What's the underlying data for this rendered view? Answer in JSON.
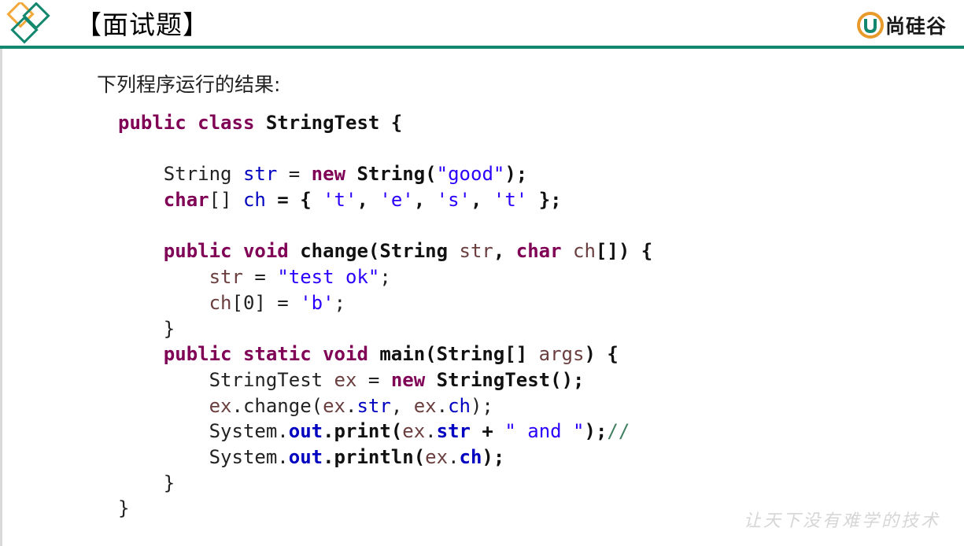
{
  "header": {
    "title": "【面试题】",
    "brand_name": "尚硅谷",
    "accent_color": "#14886f",
    "logo_colors": [
      "#f2a93b",
      "#14886f"
    ]
  },
  "question": "下列程序运行的结果:",
  "code_lines": [
    [
      {
        "t": "public",
        "c": "kw"
      },
      {
        "t": " "
      },
      {
        "t": "class",
        "c": "kw"
      },
      {
        "t": " "
      },
      {
        "t": "StringTest",
        "c": "cls"
      },
      {
        "t": " {",
        "c": "cls"
      }
    ],
    [],
    [
      {
        "t": "    String ",
        "c": "typ"
      },
      {
        "t": "str",
        "c": "fld"
      },
      {
        "t": " = "
      },
      {
        "t": "new",
        "c": "kw"
      },
      {
        "t": " "
      },
      {
        "t": "String(",
        "c": "cls"
      },
      {
        "t": "\"good\"",
        "c": "str"
      },
      {
        "t": ");",
        "c": "cls"
      }
    ],
    [
      {
        "t": "    "
      },
      {
        "t": "char",
        "c": "kw"
      },
      {
        "t": "[] "
      },
      {
        "t": "ch",
        "c": "fld"
      },
      {
        "t": " = { ",
        "c": "cls"
      },
      {
        "t": "'t'",
        "c": "str"
      },
      {
        "t": ", ",
        "c": "cls"
      },
      {
        "t": "'e'",
        "c": "str"
      },
      {
        "t": ", ",
        "c": "cls"
      },
      {
        "t": "'s'",
        "c": "str"
      },
      {
        "t": ", ",
        "c": "cls"
      },
      {
        "t": "'t'",
        "c": "str"
      },
      {
        "t": " };",
        "c": "cls"
      }
    ],
    [],
    [
      {
        "t": "    "
      },
      {
        "t": "public",
        "c": "kw"
      },
      {
        "t": " "
      },
      {
        "t": "void",
        "c": "kw"
      },
      {
        "t": " "
      },
      {
        "t": "change(String ",
        "c": "cls"
      },
      {
        "t": "str",
        "c": "var"
      },
      {
        "t": ", ",
        "c": "cls"
      },
      {
        "t": "char",
        "c": "kw"
      },
      {
        "t": " "
      },
      {
        "t": "ch",
        "c": "var"
      },
      {
        "t": "[]) {",
        "c": "cls"
      }
    ],
    [
      {
        "t": "        "
      },
      {
        "t": "str",
        "c": "var"
      },
      {
        "t": " = "
      },
      {
        "t": "\"test ok\"",
        "c": "str"
      },
      {
        "t": ";"
      }
    ],
    [
      {
        "t": "        "
      },
      {
        "t": "ch",
        "c": "var"
      },
      {
        "t": "[0] = "
      },
      {
        "t": "'b'",
        "c": "str"
      },
      {
        "t": ";"
      }
    ],
    [
      {
        "t": "    }"
      }
    ],
    [
      {
        "t": "    "
      },
      {
        "t": "public",
        "c": "kw"
      },
      {
        "t": " "
      },
      {
        "t": "static",
        "c": "kw"
      },
      {
        "t": " "
      },
      {
        "t": "void",
        "c": "kw"
      },
      {
        "t": " "
      },
      {
        "t": "main(String[] ",
        "c": "cls"
      },
      {
        "t": "args",
        "c": "var"
      },
      {
        "t": ") {",
        "c": "cls"
      }
    ],
    [
      {
        "t": "        StringTest "
      },
      {
        "t": "ex",
        "c": "var"
      },
      {
        "t": " = "
      },
      {
        "t": "new",
        "c": "kw"
      },
      {
        "t": " "
      },
      {
        "t": "StringTest();",
        "c": "cls"
      }
    ],
    [
      {
        "t": "        "
      },
      {
        "t": "ex",
        "c": "var"
      },
      {
        "t": ".change("
      },
      {
        "t": "ex",
        "c": "var"
      },
      {
        "t": "."
      },
      {
        "t": "str",
        "c": "fld"
      },
      {
        "t": ", "
      },
      {
        "t": "ex",
        "c": "var"
      },
      {
        "t": "."
      },
      {
        "t": "ch",
        "c": "fld"
      },
      {
        "t": ");"
      }
    ],
    [
      {
        "t": "        System."
      },
      {
        "t": "out",
        "c": "sfld"
      },
      {
        "t": ".print(",
        "c": "cls"
      },
      {
        "t": "ex",
        "c": "var"
      },
      {
        "t": "."
      },
      {
        "t": "str",
        "c": "sfld"
      },
      {
        "t": " + ",
        "c": "cls"
      },
      {
        "t": "\" and \"",
        "c": "str"
      },
      {
        "t": ");",
        "c": "cls"
      },
      {
        "t": "//",
        "c": "cmt"
      }
    ],
    [
      {
        "t": "        System."
      },
      {
        "t": "out",
        "c": "sfld"
      },
      {
        "t": ".println(",
        "c": "cls"
      },
      {
        "t": "ex",
        "c": "var"
      },
      {
        "t": "."
      },
      {
        "t": "ch",
        "c": "sfld"
      },
      {
        "t": ");",
        "c": "cls"
      }
    ],
    [
      {
        "t": "    }"
      }
    ],
    [
      {
        "t": "}"
      }
    ]
  ],
  "watermark": "让天下没有难学的技术"
}
